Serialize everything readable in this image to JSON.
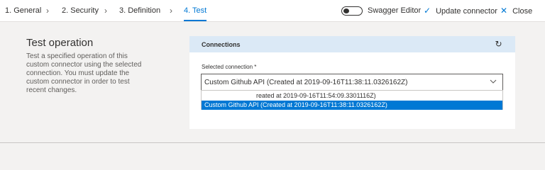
{
  "wizard": {
    "steps": [
      {
        "label": "1. General"
      },
      {
        "label": "2. Security"
      },
      {
        "label": "3. Definition"
      },
      {
        "label": "4. Test"
      }
    ],
    "active_step": 3
  },
  "toolbar": {
    "swagger_label": "Swagger Editor",
    "swagger_enabled": false,
    "update_label": "Update connector",
    "update_icon": "checkmark-icon",
    "close_label": "Close",
    "close_icon": "close-icon"
  },
  "section": {
    "title": "Test operation",
    "description": "Test a specified operation of this custom connector using the selected connection. You must update the custom connector in order to test recent changes."
  },
  "connections": {
    "title": "Connections",
    "refresh_icon": "refresh-icon",
    "field_label": "Selected connection *",
    "selected_value": "Custom Github API (Created at 2019-09-16T11:38:11.0326162Z)",
    "options": [
      "reated at 2019-09-16T11:54:09.3301116Z)",
      "Custom Github API (Created at 2019-09-16T11:38:11.0326162Z)"
    ],
    "highlight_color": "#0078d4"
  },
  "colors": {
    "accent": "#0078d4",
    "header_bg": "#dbe9f6",
    "page_bg": "#f3f2f1"
  }
}
